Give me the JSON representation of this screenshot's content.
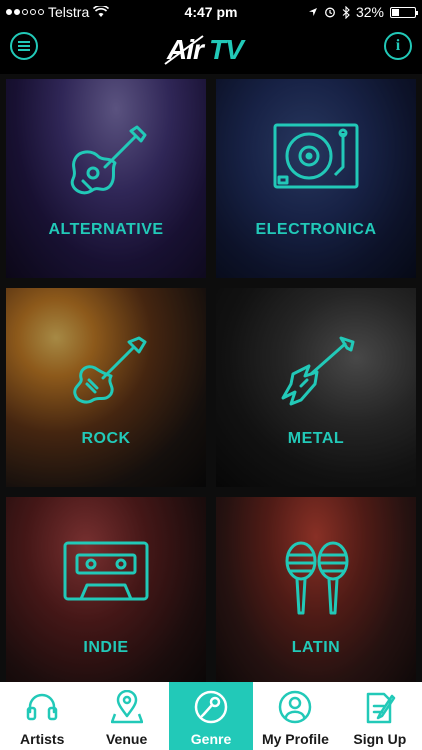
{
  "status_bar": {
    "carrier": "Telstra",
    "time": "4:47 pm",
    "battery": "32%",
    "battery_level": 0.32
  },
  "header": {
    "logo_text": "AirTV"
  },
  "genres": [
    {
      "label": "ALTERNATIVE",
      "icon": "acoustic-guitar-icon"
    },
    {
      "label": "ELECTRONICA",
      "icon": "turntable-icon"
    },
    {
      "label": "ROCK",
      "icon": "electric-guitar-icon"
    },
    {
      "label": "METAL",
      "icon": "metal-guitar-icon"
    },
    {
      "label": "INDIE",
      "icon": "cassette-icon"
    },
    {
      "label": "LATIN",
      "icon": "maracas-icon"
    }
  ],
  "tabs": [
    {
      "label": "Artists",
      "icon": "headphones-icon"
    },
    {
      "label": "Venue",
      "icon": "map-pin-icon"
    },
    {
      "label": "Genre",
      "icon": "microphone-icon",
      "active": true
    },
    {
      "label": "My Profile",
      "icon": "profile-icon"
    },
    {
      "label": "Sign Up",
      "icon": "sign-up-icon"
    }
  ],
  "colors": {
    "accent": "#22c9b8",
    "background": "#000000",
    "tabbar": "#ffffff"
  }
}
